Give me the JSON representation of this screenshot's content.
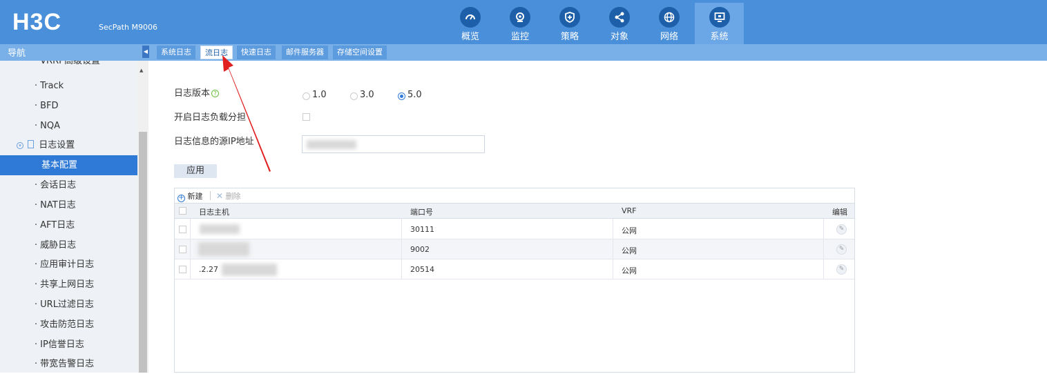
{
  "header": {
    "logo": "H3C",
    "model": "SecPath M9006",
    "nav": [
      {
        "label": "概览",
        "icon": "dashboard-icon"
      },
      {
        "label": "监控",
        "icon": "monitor-icon"
      },
      {
        "label": "策略",
        "icon": "shield-icon"
      },
      {
        "label": "对象",
        "icon": "share-icon"
      },
      {
        "label": "网络",
        "icon": "globe-icon"
      },
      {
        "label": "系统",
        "icon": "display-icon"
      }
    ],
    "active_nav": "系统"
  },
  "subnav": {
    "title": "导航",
    "tabs": [
      "系统日志",
      "流日志",
      "快速日志",
      "邮件服务器",
      "存储空间设置"
    ],
    "active_tab": "流日志"
  },
  "sidebar": {
    "items": [
      {
        "label": "VRRP高级设置"
      },
      {
        "label": "Track"
      },
      {
        "label": "BFD"
      },
      {
        "label": "NQA"
      },
      {
        "label": "日志设置"
      },
      {
        "label": "基本配置"
      },
      {
        "label": "会话日志"
      },
      {
        "label": "NAT日志"
      },
      {
        "label": "AFT日志"
      },
      {
        "label": "威胁日志"
      },
      {
        "label": "应用审计日志"
      },
      {
        "label": "共享上网日志"
      },
      {
        "label": "URL过滤日志"
      },
      {
        "label": "攻击防范日志"
      },
      {
        "label": "IP信誉日志"
      },
      {
        "label": "带宽告警日志"
      }
    ],
    "active_item": "基本配置"
  },
  "form": {
    "version_label": "日志版本",
    "version_options": [
      "1.0",
      "3.0",
      "5.0"
    ],
    "version_selected": "5.0",
    "load_balance_label": "开启日志负载分担",
    "load_balance_checked": false,
    "source_ip_label": "日志信息的源IP地址",
    "apply_label": "应用"
  },
  "grid": {
    "toolbar": {
      "new_label": "新建",
      "delete_label": "删除"
    },
    "columns": [
      "日志主机",
      "端口号",
      "VRF",
      "编辑"
    ],
    "rows": [
      {
        "host": "",
        "port": "30111",
        "vrf": "公网"
      },
      {
        "host": "",
        "port": "9002",
        "vrf": "公网"
      },
      {
        "host": ".2.27",
        "port": "20514",
        "vrf": "公网"
      }
    ]
  },
  "colors": {
    "topbar": "#4a8fd9",
    "subbar": "#79b0e8",
    "active_sidebar": "#2f7ad6",
    "annotation_arrow": "#e02020"
  }
}
